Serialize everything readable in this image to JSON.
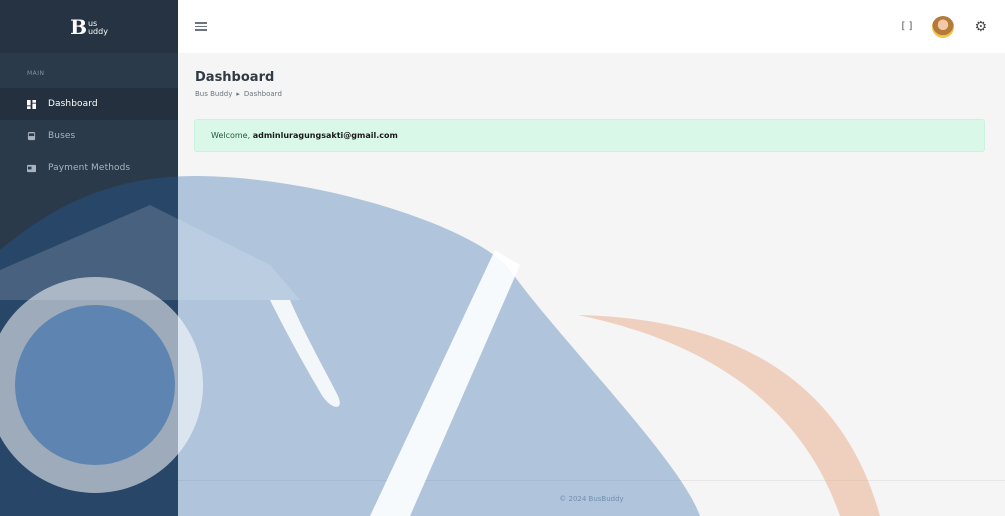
{
  "brand": {
    "big": "B",
    "small_top": "us",
    "small_bottom": "uddy"
  },
  "sidebar": {
    "menu_title": "MAIN",
    "items": [
      {
        "label": "Dashboard",
        "icon": "dashboard-icon",
        "active": true
      },
      {
        "label": "Buses",
        "icon": "bus-icon",
        "active": false
      },
      {
        "label": "Payment Methods",
        "icon": "credit-card-icon",
        "active": false
      }
    ]
  },
  "topbar": {
    "fullscreen_icon": "fullscreen-icon",
    "settings_icon": "gear-icon"
  },
  "page": {
    "title": "Dashboard",
    "breadcrumb": [
      "Bus Buddy",
      "Dashboard"
    ],
    "breadcrumb_sep": "▸"
  },
  "alert": {
    "prefix": "Welcome, ",
    "email": "adminluragungsakti@gmail.com"
  },
  "footer": {
    "text": "© 2024 BusBuddy"
  },
  "colors": {
    "sidebar": "#2b3a4a",
    "alert_bg": "#d9f8e7",
    "watermark_blue": "#1f5fa8",
    "watermark_orange": "#e8a27a"
  }
}
